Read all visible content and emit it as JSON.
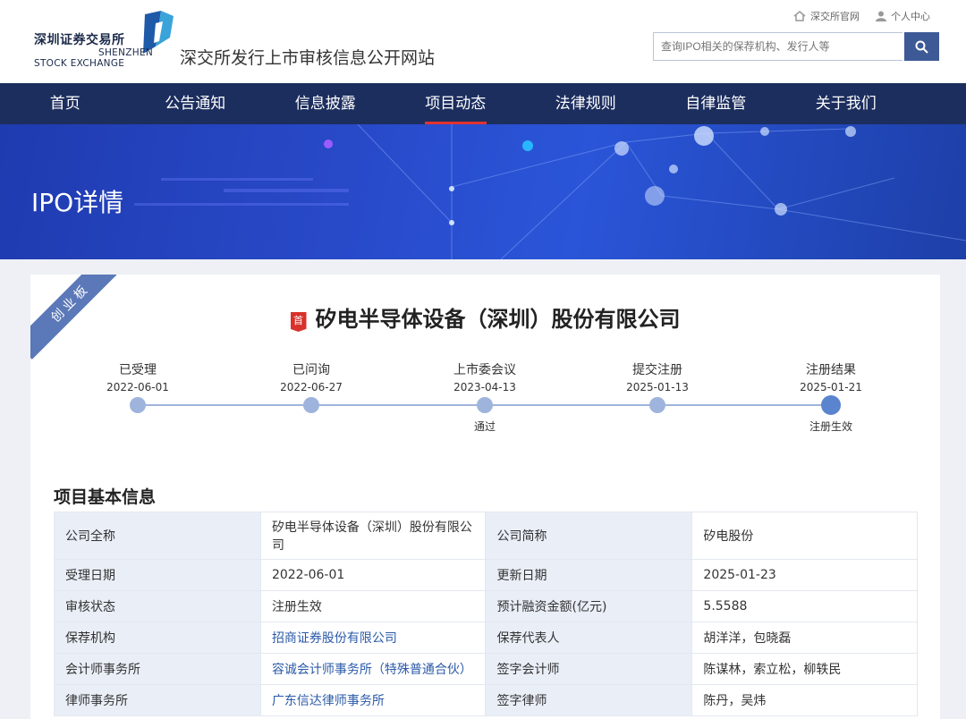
{
  "header": {
    "logo_cn": "深圳证券交易所",
    "logo_en_line1": "SHENZHEN",
    "logo_en_line2": "STOCK EXCHANGE",
    "site_title": "深交所发行上市审核信息公开网站",
    "top_links": [
      "深交所官网",
      "个人中心"
    ],
    "search_placeholder": "查询IPO相关的保荐机构、发行人等"
  },
  "nav": {
    "items": [
      "首页",
      "公告通知",
      "信息披露",
      "项目动态",
      "法律规则",
      "自律监管",
      "关于我们"
    ],
    "active": "项目动态"
  },
  "banner": {
    "title": "IPO详情"
  },
  "card": {
    "board_ribbon": "创业板",
    "badge": "首",
    "company_name": "矽电半导体设备（深圳）股份有限公司",
    "timeline": [
      {
        "name": "已受理",
        "date": "2022-06-01",
        "note": ""
      },
      {
        "name": "已问询",
        "date": "2022-06-27",
        "note": ""
      },
      {
        "name": "上市委会议",
        "date": "2023-04-13",
        "note": "通过"
      },
      {
        "name": "提交注册",
        "date": "2025-01-13",
        "note": ""
      },
      {
        "name": "注册结果",
        "date": "2025-01-21",
        "note": "注册生效"
      }
    ],
    "section_title": "项目基本信息",
    "rows": [
      {
        "l1": "公司全称",
        "v1": "矽电半导体设备（深圳）股份有限公司",
        "l2": "公司简称",
        "v2": "矽电股份"
      },
      {
        "l1": "受理日期",
        "v1": "2022-06-01",
        "l2": "更新日期",
        "v2": "2025-01-23"
      },
      {
        "l1": "审核状态",
        "v1": "注册生效",
        "l2": "预计融资金额(亿元)",
        "v2": "5.5588"
      },
      {
        "l1": "保荐机构",
        "v1": "招商证券股份有限公司",
        "l2": "保荐代表人",
        "v2": "胡洋洋，包晓磊"
      },
      {
        "l1": "会计师事务所",
        "v1": "容诚会计师事务所（特殊普通合伙）",
        "l2": "签字会计师",
        "v2": "陈谋林，索立松，柳轶民"
      },
      {
        "l1": "律师事务所",
        "v1": "广东信达律师事务所",
        "l2": "签字律师",
        "v2": "陈丹，吴炜"
      }
    ]
  }
}
